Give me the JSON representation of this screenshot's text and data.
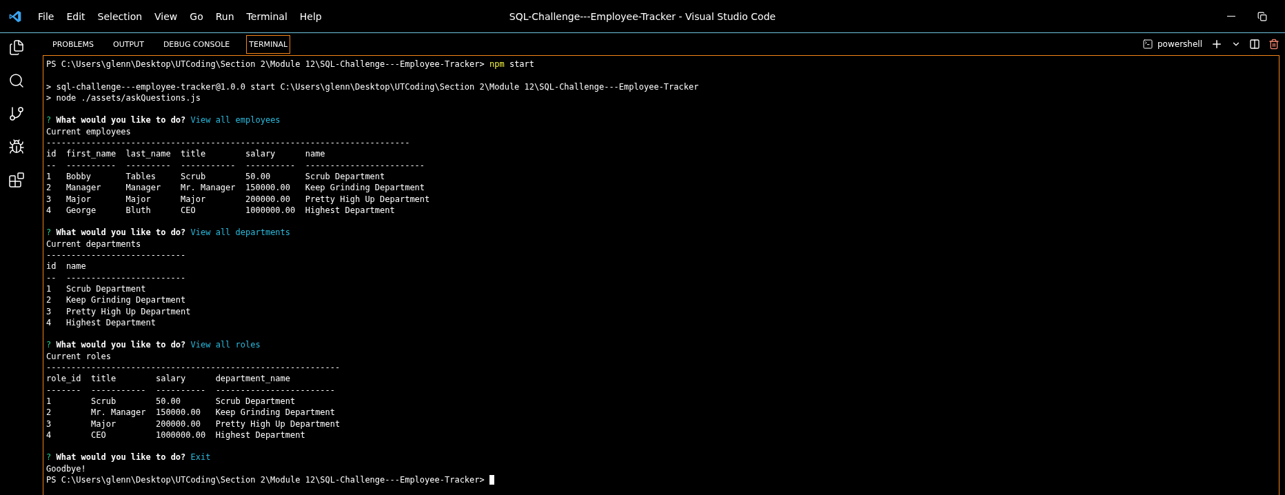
{
  "window": {
    "title": "SQL-Challenge---Employee-Tracker - Visual Studio Code"
  },
  "menu": [
    "File",
    "Edit",
    "Selection",
    "View",
    "Go",
    "Run",
    "Terminal",
    "Help"
  ],
  "panel_tabs": [
    {
      "label": "PROBLEMS",
      "selected": false
    },
    {
      "label": "OUTPUT",
      "selected": false
    },
    {
      "label": "DEBUG CONSOLE",
      "selected": false
    },
    {
      "label": "TERMINAL",
      "selected": true
    }
  ],
  "terminal_picker": {
    "label": "powershell"
  },
  "terminal": {
    "lines": [
      {
        "kind": "shell",
        "prompt": "PS C:\\Users\\glenn\\Desktop\\UTCoding\\Section 2\\Module 12\\SQL-Challenge---Employee-Tracker>",
        "command": "npm",
        "args": "start",
        "cursor": false
      },
      {
        "kind": "blank"
      },
      {
        "kind": "output",
        "text": "> sql-challenge---employee-tracker@1.0.0 start C:\\Users\\glenn\\Desktop\\UTCoding\\Section 2\\Module 12\\SQL-Challenge---Employee-Tracker"
      },
      {
        "kind": "output",
        "text": "> node ./assets/askQuestions.js"
      },
      {
        "kind": "blank"
      },
      {
        "kind": "question",
        "mark": "?",
        "question": "What would you like to do?",
        "answer": "View all employees"
      },
      {
        "kind": "output",
        "text": "Current employees"
      },
      {
        "kind": "output",
        "text": "-------------------------------------------------------------------------"
      },
      {
        "kind": "output",
        "text": "id  first_name  last_name  title        salary      name"
      },
      {
        "kind": "output",
        "text": "--  ----------  ---------  -----------  ----------  ------------------------"
      },
      {
        "kind": "output",
        "text": "1   Bobby       Tables     Scrub        50.00       Scrub Department"
      },
      {
        "kind": "output",
        "text": "2   Manager     Manager    Mr. Manager  150000.00   Keep Grinding Department"
      },
      {
        "kind": "output",
        "text": "3   Major       Major      Major        200000.00   Pretty High Up Department"
      },
      {
        "kind": "output",
        "text": "4   George      Bluth      CEO          1000000.00  Highest Department"
      },
      {
        "kind": "blank"
      },
      {
        "kind": "question",
        "mark": "?",
        "question": "What would you like to do?",
        "answer": "View all departments"
      },
      {
        "kind": "output",
        "text": "Current departments"
      },
      {
        "kind": "output",
        "text": "----------------------------"
      },
      {
        "kind": "output",
        "text": "id  name"
      },
      {
        "kind": "output",
        "text": "--  ------------------------"
      },
      {
        "kind": "output",
        "text": "1   Scrub Department"
      },
      {
        "kind": "output",
        "text": "2   Keep Grinding Department"
      },
      {
        "kind": "output",
        "text": "3   Pretty High Up Department"
      },
      {
        "kind": "output",
        "text": "4   Highest Department"
      },
      {
        "kind": "blank"
      },
      {
        "kind": "question",
        "mark": "?",
        "question": "What would you like to do?",
        "answer": "View all roles"
      },
      {
        "kind": "output",
        "text": "Current roles"
      },
      {
        "kind": "output",
        "text": "-----------------------------------------------------------"
      },
      {
        "kind": "output",
        "text": "role_id  title        salary      department_name"
      },
      {
        "kind": "output",
        "text": "-------  -----------  ----------  ------------------------"
      },
      {
        "kind": "output",
        "text": "1        Scrub        50.00       Scrub Department"
      },
      {
        "kind": "output",
        "text": "2        Mr. Manager  150000.00   Keep Grinding Department"
      },
      {
        "kind": "output",
        "text": "3        Major        200000.00   Pretty High Up Department"
      },
      {
        "kind": "output",
        "text": "4        CEO          1000000.00  Highest Department"
      },
      {
        "kind": "blank"
      },
      {
        "kind": "question",
        "mark": "?",
        "question": "What would you like to do?",
        "answer": "Exit"
      },
      {
        "kind": "output",
        "text": "Goodbye!"
      },
      {
        "kind": "shell",
        "prompt": "PS C:\\Users\\glenn\\Desktop\\UTCoding\\Section 2\\Module 12\\SQL-Challenge---Employee-Tracker>",
        "cursor": true
      }
    ]
  }
}
